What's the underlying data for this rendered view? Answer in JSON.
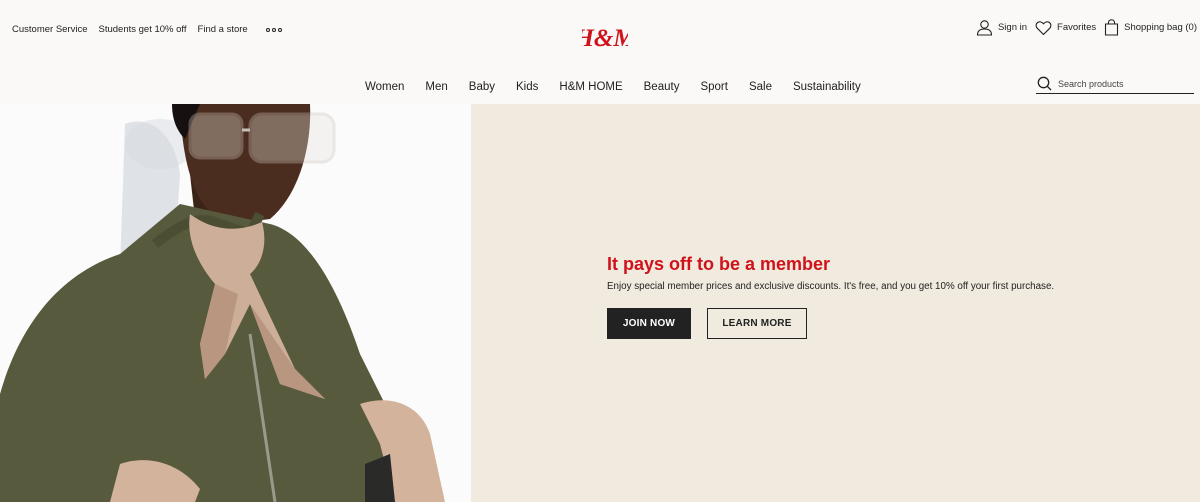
{
  "header": {
    "utility_links": [
      "Customer Service",
      "Students get 10% off",
      "Find a store"
    ],
    "more_icon": "ellipsis-icon",
    "logo_text": "H&M",
    "brand_color": "#d0121a",
    "account": {
      "sign_in": "Sign in",
      "favorites": "Favorites",
      "shopping_bag": "Shopping bag (0)"
    },
    "nav": [
      "Women",
      "Men",
      "Baby",
      "Kids",
      "H&M HOME",
      "Beauty",
      "Sport",
      "Sale",
      "Sustainability"
    ],
    "search_placeholder": "Search products"
  },
  "hero": {
    "title": "It pays off to be a member",
    "text": "Enjoy special member prices and exclusive discounts. It's free, and you get 10% off your first purchase.",
    "join_label": "JOIN NOW",
    "learn_label": "LEARN MORE",
    "panel_color": "#f1eadf"
  }
}
